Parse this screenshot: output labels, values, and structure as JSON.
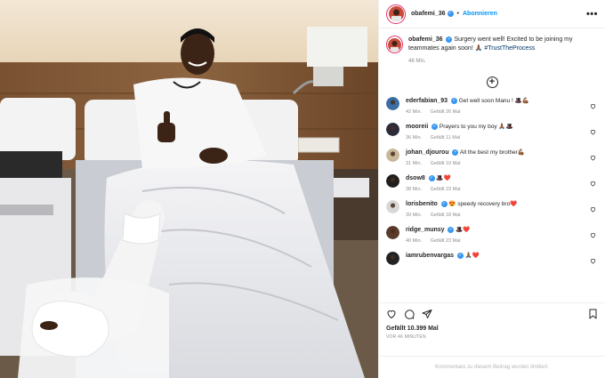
{
  "header": {
    "username": "obafemi_36",
    "separator": "•",
    "follow_label": "Abonnieren",
    "more": "•••"
  },
  "caption": {
    "username": "obafemi_36",
    "text": "Surgery went well! Excited to be joining my teammates again soon! 🙏🏾",
    "hashtag": "#TrustTheProcess",
    "time": "46 Min."
  },
  "load_more": "+",
  "comments": [
    {
      "user": "ederfabian_93",
      "text": "Get well soon Manu ! 🎩💪🏾",
      "time": "42 Min.",
      "likes": "Gefällt 26 Mal",
      "avatar_color": "#3a6ea5"
    },
    {
      "user": "mooreii",
      "text": "Prayers to you my boy 🙏🏾🎩",
      "time": "36 Min.",
      "likes": "Gefällt 11 Mal",
      "avatar_color": "#2b2b3a"
    },
    {
      "user": "johan_djourou",
      "text": "All the best my brother💪🏾",
      "time": "31 Min.",
      "likes": "Gefällt 10 Mal",
      "avatar_color": "#c9b79a"
    },
    {
      "user": "dsow8",
      "text": "🎩❤️",
      "time": "38 Min.",
      "likes": "Gefällt 23 Mal",
      "avatar_color": "#1f1f1f"
    },
    {
      "user": "lorisbenito",
      "text": "😍 speedy recovery bro❤️",
      "time": "39 Min.",
      "likes": "Gefällt 18 Mal",
      "avatar_color": "#d8d8d8"
    },
    {
      "user": "ridge_munsy",
      "text": "🎩❤️",
      "time": "40 Min.",
      "likes": "Gefällt 23 Mal",
      "avatar_color": "#5a3a2a"
    },
    {
      "user": "iamrubenvargas",
      "text": "🙏🏾❤️",
      "time": "",
      "likes": "",
      "avatar_color": "#222"
    }
  ],
  "actions": {
    "likes": "Gefällt 10.399 Mal",
    "ago": "VOR 46 MINUTEN"
  },
  "footer": {
    "text": "Kommentare zu diesem Beitrag wurden limitiert."
  },
  "colors": {
    "accent": "#0095f6",
    "verified": "#3897f0",
    "muted": "#8e8e8e"
  }
}
